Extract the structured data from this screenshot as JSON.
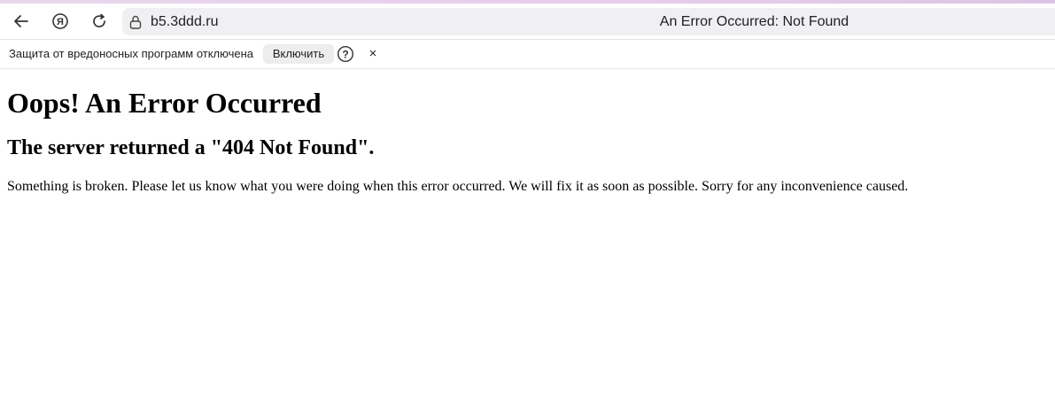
{
  "browser": {
    "url": "b5.3ddd.ru",
    "tab_title": "An Error Occurred: Not Found",
    "icons": {
      "back": "arrow-left-icon",
      "yandex": "yandex-logo-icon",
      "reload": "reload-icon",
      "lock": "lock-icon"
    },
    "infobar": {
      "message": "Защита от вредоносных программ отключена",
      "enable_label": "Включить",
      "help_label": "?",
      "close_label": "×"
    }
  },
  "page": {
    "heading": "Oops! An Error Occurred",
    "subheading": "The server returned a \"404 Not Found\".",
    "message": "Something is broken. Please let us know what you were doing when this error occurred. We will fix it as soon as possible. Sorry for any inconvenience caused."
  }
}
